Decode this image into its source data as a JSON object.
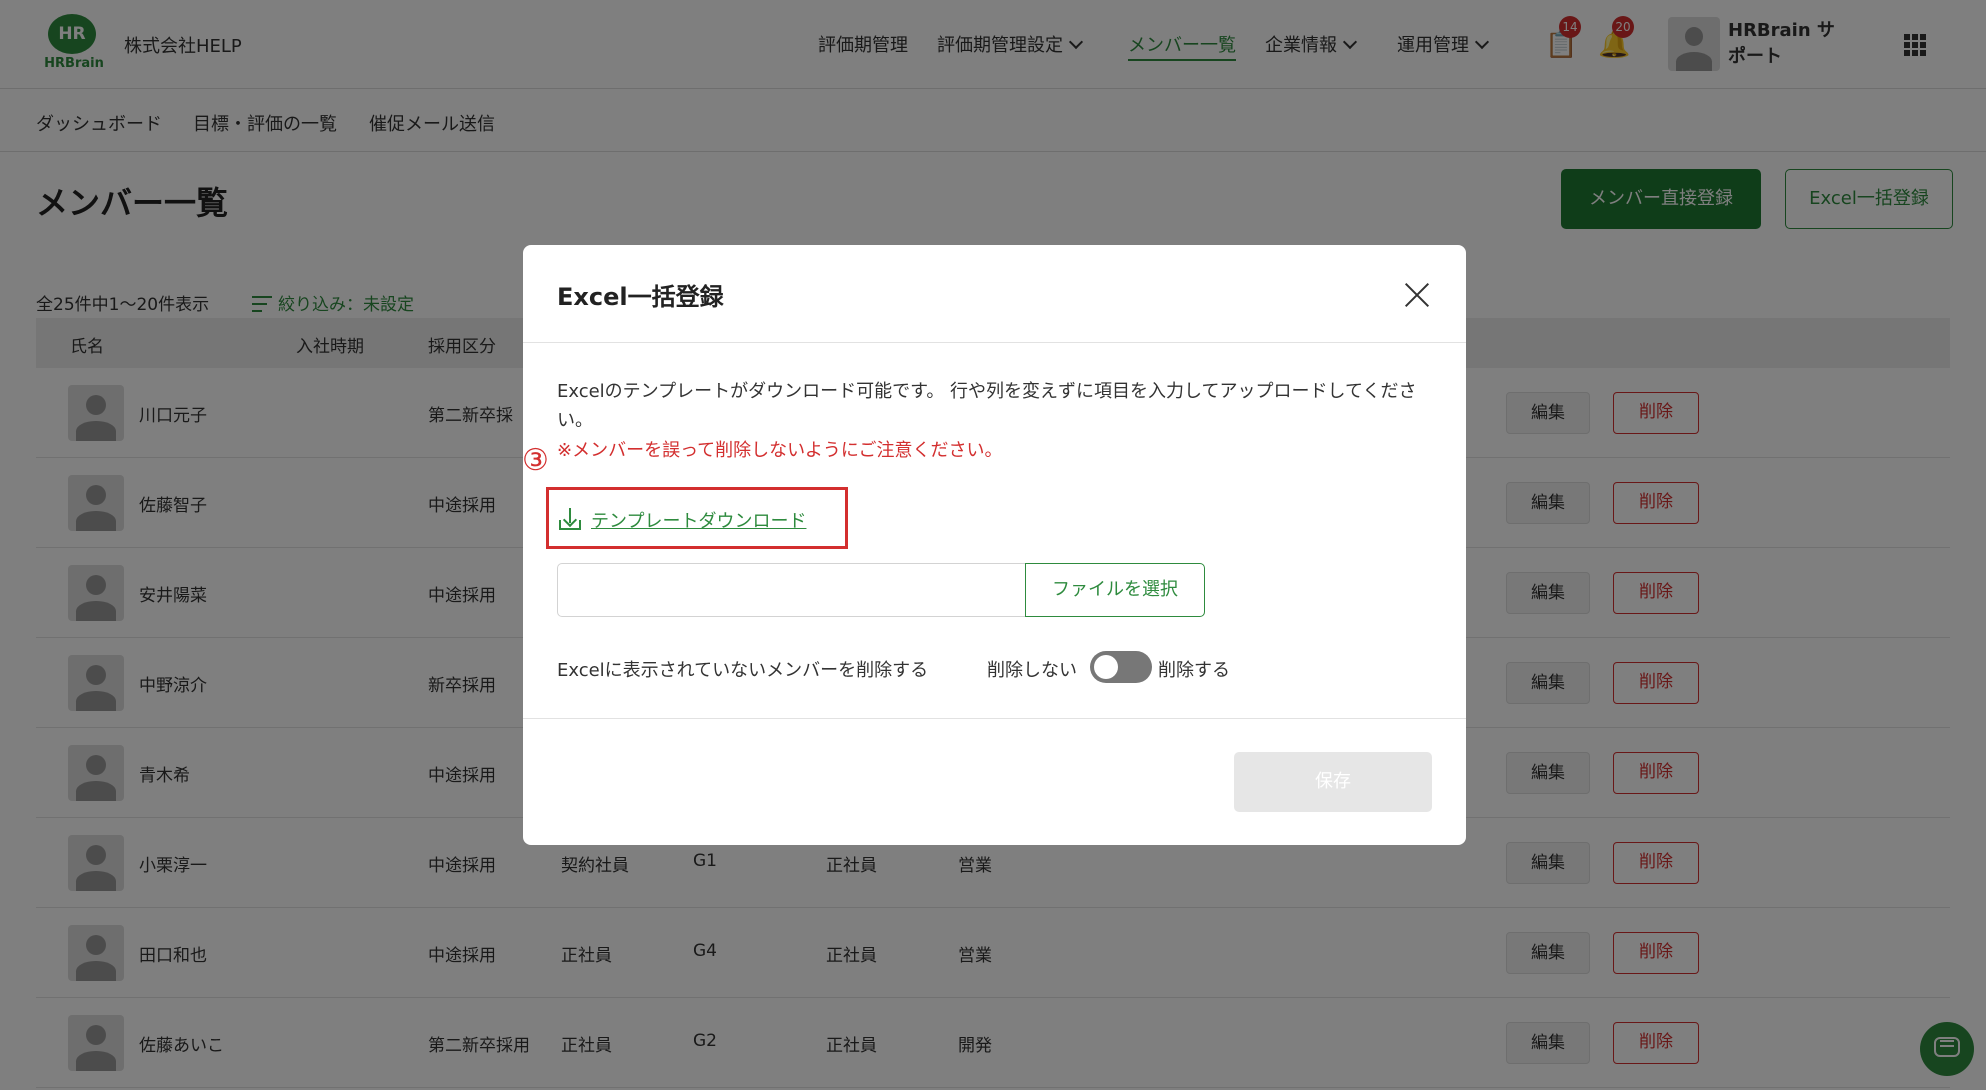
{
  "header": {
    "logo_top": "HR",
    "logo_brand": "HRBrain",
    "company": "株式会社HELP",
    "nav": [
      {
        "label": "評価期管理"
      },
      {
        "label": "評価期管理設定"
      },
      {
        "label": "メンバー一覧"
      },
      {
        "label": "企業情報"
      },
      {
        "label": "運用管理"
      }
    ],
    "task_badge": "14",
    "notification_badge": "20",
    "user_name": "HRBrain サポート"
  },
  "subnav": [
    "ダッシュボード",
    "目標・評価の一覧",
    "催促メール送信"
  ],
  "page": {
    "title": "メンバー一覧",
    "direct_register": "メンバー直接登録",
    "excel_register": "Excel一括登録",
    "count": "全25件中1〜20件表示",
    "filter": "絞り込み：未設定"
  },
  "table": {
    "headers": [
      "氏名",
      "入社時期",
      "採用区分"
    ],
    "rows": [
      {
        "name": "川口元子",
        "hire_type": "第二新卒採",
        "employment": "",
        "grade": "",
        "status": "",
        "dept": ""
      },
      {
        "name": "佐藤智子",
        "hire_type": "中途採用",
        "employment": "",
        "grade": "",
        "status": "",
        "dept": ""
      },
      {
        "name": "安井陽菜",
        "hire_type": "中途採用",
        "employment": "",
        "grade": "",
        "status": "",
        "dept": ""
      },
      {
        "name": "中野涼介",
        "hire_type": "新卒採用",
        "employment": "",
        "grade": "",
        "status": "",
        "dept": ""
      },
      {
        "name": "青木希",
        "hire_type": "中途採用",
        "employment": "",
        "grade": "",
        "status": "",
        "dept": ""
      },
      {
        "name": "小栗淳一",
        "hire_type": "中途採用",
        "employment": "契約社員",
        "grade": "G1",
        "status": "正社員",
        "dept": "営業"
      },
      {
        "name": "田口和也",
        "hire_type": "中途採用",
        "employment": "正社員",
        "grade": "G4",
        "status": "正社員",
        "dept": "営業"
      },
      {
        "name": "佐藤あいこ",
        "hire_type": "第二新卒採用",
        "employment": "正社員",
        "grade": "G2",
        "status": "正社員",
        "dept": "開発"
      }
    ],
    "edit_label": "編集",
    "delete_label": "削除"
  },
  "modal": {
    "title": "Excel一括登録",
    "description": "Excelのテンプレートがダウンロード可能です。 行や列を変えずに項目を入力してアップロードしてください。",
    "warning": "※メンバーを誤って削除しないようにご注意ください。",
    "step_marker": "③",
    "download_label": "テンプレートダウンロード",
    "file_value": "",
    "file_button": "ファイルを選択",
    "option_label": "Excelに表示されていないメンバーを削除する",
    "toggle_off_label": "削除しない",
    "toggle_on_label": "削除する",
    "save_label": "保存"
  },
  "colors": {
    "brand_green": "#2e8b3e",
    "danger_red": "#d32f2f"
  }
}
